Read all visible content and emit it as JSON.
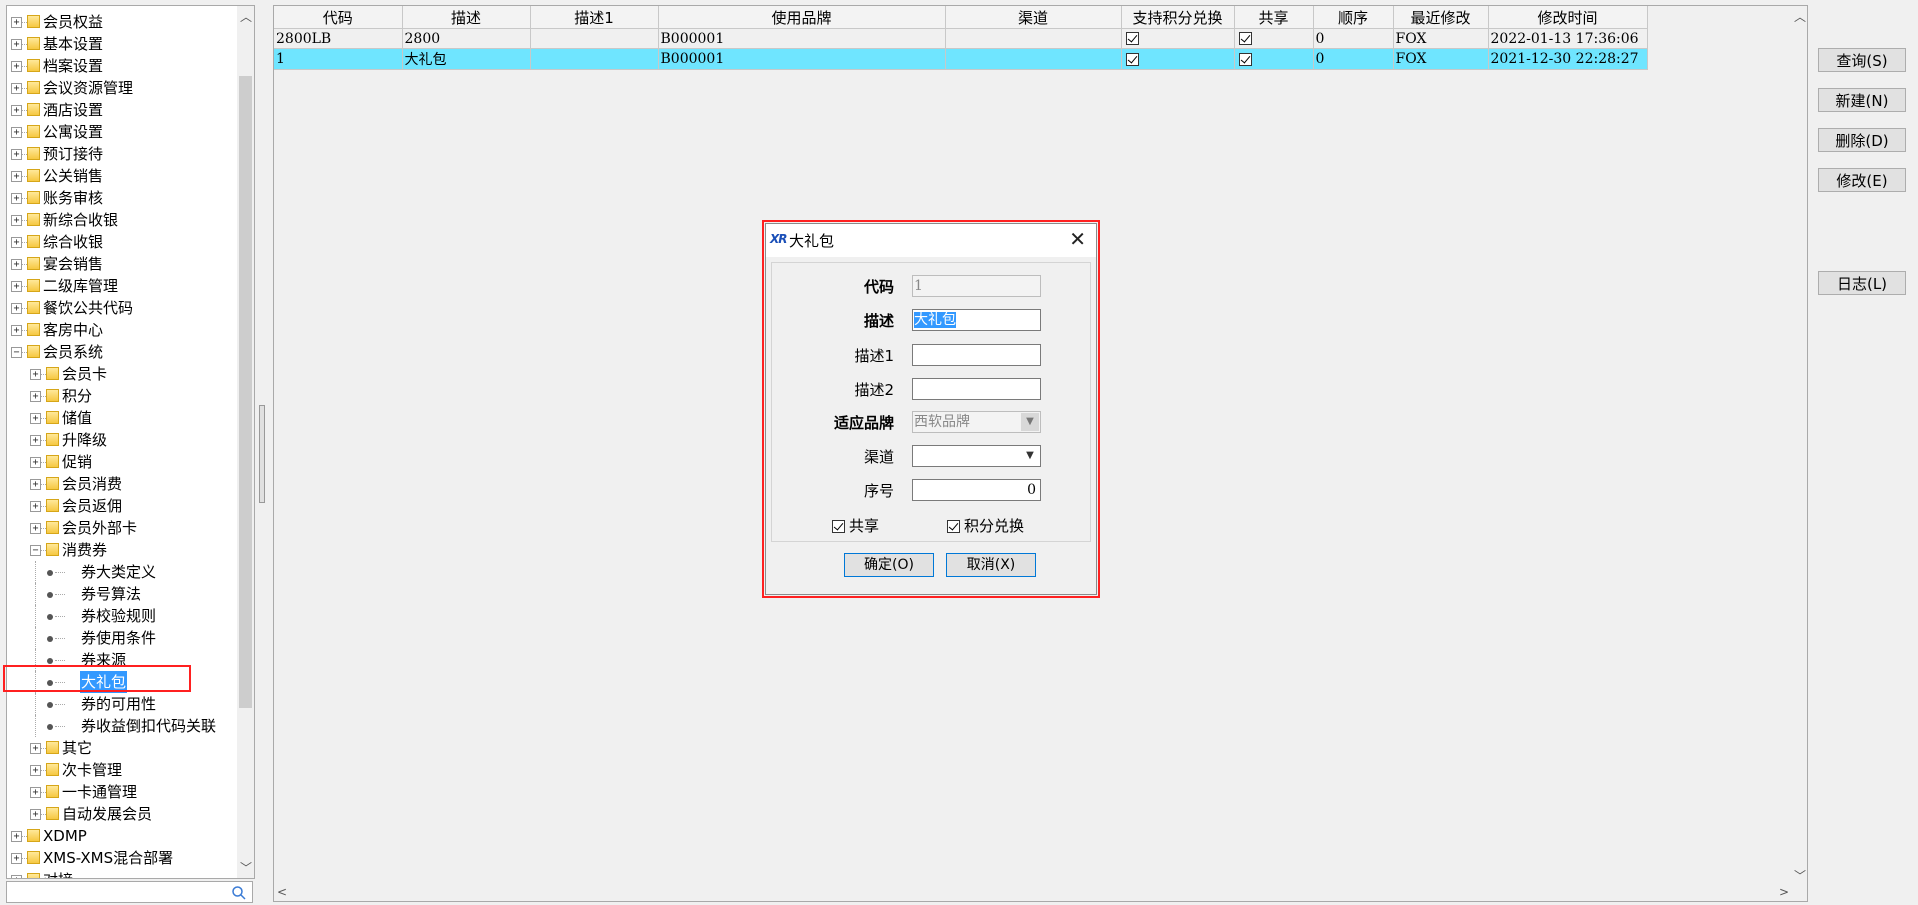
{
  "tree": {
    "items": [
      {
        "label": "会员权益",
        "level": 0,
        "type": "folder",
        "expanded": false
      },
      {
        "label": "基本设置",
        "level": 0,
        "type": "folder",
        "expanded": false
      },
      {
        "label": "档案设置",
        "level": 0,
        "type": "folder",
        "expanded": false
      },
      {
        "label": "会议资源管理",
        "level": 0,
        "type": "folder",
        "expanded": false
      },
      {
        "label": "酒店设置",
        "level": 0,
        "type": "folder",
        "expanded": false
      },
      {
        "label": "公寓设置",
        "level": 0,
        "type": "folder",
        "expanded": false
      },
      {
        "label": "预订接待",
        "level": 0,
        "type": "folder",
        "expanded": false
      },
      {
        "label": "公关销售",
        "level": 0,
        "type": "folder",
        "expanded": false
      },
      {
        "label": "账务审核",
        "level": 0,
        "type": "folder",
        "expanded": false
      },
      {
        "label": "新综合收银",
        "level": 0,
        "type": "folder",
        "expanded": false
      },
      {
        "label": "综合收银",
        "level": 0,
        "type": "folder",
        "expanded": false
      },
      {
        "label": "宴会销售",
        "level": 0,
        "type": "folder",
        "expanded": false
      },
      {
        "label": "二级库管理",
        "level": 0,
        "type": "folder",
        "expanded": false
      },
      {
        "label": "餐饮公共代码",
        "level": 0,
        "type": "folder",
        "expanded": false
      },
      {
        "label": "客房中心",
        "level": 0,
        "type": "folder",
        "expanded": false
      },
      {
        "label": "会员系统",
        "level": 0,
        "type": "folder",
        "expanded": true
      },
      {
        "label": "会员卡",
        "level": 1,
        "type": "folder",
        "expanded": false
      },
      {
        "label": "积分",
        "level": 1,
        "type": "folder",
        "expanded": false
      },
      {
        "label": "储值",
        "level": 1,
        "type": "folder",
        "expanded": false
      },
      {
        "label": "升降级",
        "level": 1,
        "type": "folder",
        "expanded": false
      },
      {
        "label": "促销",
        "level": 1,
        "type": "folder",
        "expanded": false
      },
      {
        "label": "会员消费",
        "level": 1,
        "type": "folder",
        "expanded": false
      },
      {
        "label": "会员返佣",
        "level": 1,
        "type": "folder",
        "expanded": false
      },
      {
        "label": "会员外部卡",
        "level": 1,
        "type": "folder",
        "expanded": false
      },
      {
        "label": "消费券",
        "level": 1,
        "type": "folder",
        "expanded": true
      },
      {
        "label": "券大类定义",
        "level": 2,
        "type": "leaf"
      },
      {
        "label": "券号算法",
        "level": 2,
        "type": "leaf"
      },
      {
        "label": "券校验规则",
        "level": 2,
        "type": "leaf"
      },
      {
        "label": "券使用条件",
        "level": 2,
        "type": "leaf"
      },
      {
        "label": "券来源",
        "level": 2,
        "type": "leaf"
      },
      {
        "label": "大礼包",
        "level": 2,
        "type": "leaf",
        "selected": true
      },
      {
        "label": "券的可用性",
        "level": 2,
        "type": "leaf"
      },
      {
        "label": "券收益倒扣代码关联",
        "level": 2,
        "type": "leaf"
      },
      {
        "label": "其它",
        "level": 1,
        "type": "folder",
        "expanded": false
      },
      {
        "label": "次卡管理",
        "level": 1,
        "type": "folder",
        "expanded": false
      },
      {
        "label": "一卡通管理",
        "level": 1,
        "type": "folder",
        "expanded": false
      },
      {
        "label": "自动发展会员",
        "level": 1,
        "type": "folder",
        "expanded": false
      },
      {
        "label": "XDMP",
        "level": 0,
        "type": "folder",
        "expanded": false
      },
      {
        "label": "XMS-XMS混合部署",
        "level": 0,
        "type": "folder",
        "expanded": false
      },
      {
        "label": "对接",
        "level": 0,
        "type": "folder",
        "expanded": false
      }
    ],
    "search_value": ""
  },
  "grid": {
    "columns": [
      "代码",
      "描述",
      "描述1",
      "使用品牌",
      "渠道",
      "支持积分兑换",
      "共享",
      "顺序",
      "最近修改",
      "修改时间"
    ],
    "rows": [
      {
        "code": "2800LB",
        "desc": "2800",
        "desc1": "",
        "brand": "B000001",
        "channel": "",
        "points": true,
        "shared": true,
        "order": "0",
        "modified_by": "FOX",
        "modified_at": "2022-01-13 17:36:06",
        "selected": false
      },
      {
        "code": "1",
        "desc": "大礼包",
        "desc1": "",
        "brand": "B000001",
        "channel": "",
        "points": true,
        "shared": true,
        "order": "0",
        "modified_by": "FOX",
        "modified_at": "2021-12-30 22:28:27",
        "selected": true
      }
    ],
    "selected_row_color": "#6fe5ff"
  },
  "toolbar": {
    "query_label": "查询(S)",
    "new_label": "新建(N)",
    "delete_label": "删除(D)",
    "edit_label": "修改(E)",
    "log_label": "日志(L)"
  },
  "dialog": {
    "logo": "XR",
    "title": "大礼包",
    "fields": {
      "code_label": "代码",
      "code_value": "1",
      "desc_label": "描述",
      "desc_value": "大礼包",
      "desc1_label": "描述1",
      "desc1_value": "",
      "desc2_label": "描述2",
      "desc2_value": "",
      "brand_label": "适应品牌",
      "brand_value": "西软品牌",
      "channel_label": "渠道",
      "channel_value": "",
      "order_label": "序号",
      "order_value": "0"
    },
    "shared_label": "共享",
    "shared_checked": true,
    "points_label": "积分兑换",
    "points_checked": true,
    "ok_label": "确定(O)",
    "cancel_label": "取消(X)"
  },
  "highlight_color": "#ff2020"
}
